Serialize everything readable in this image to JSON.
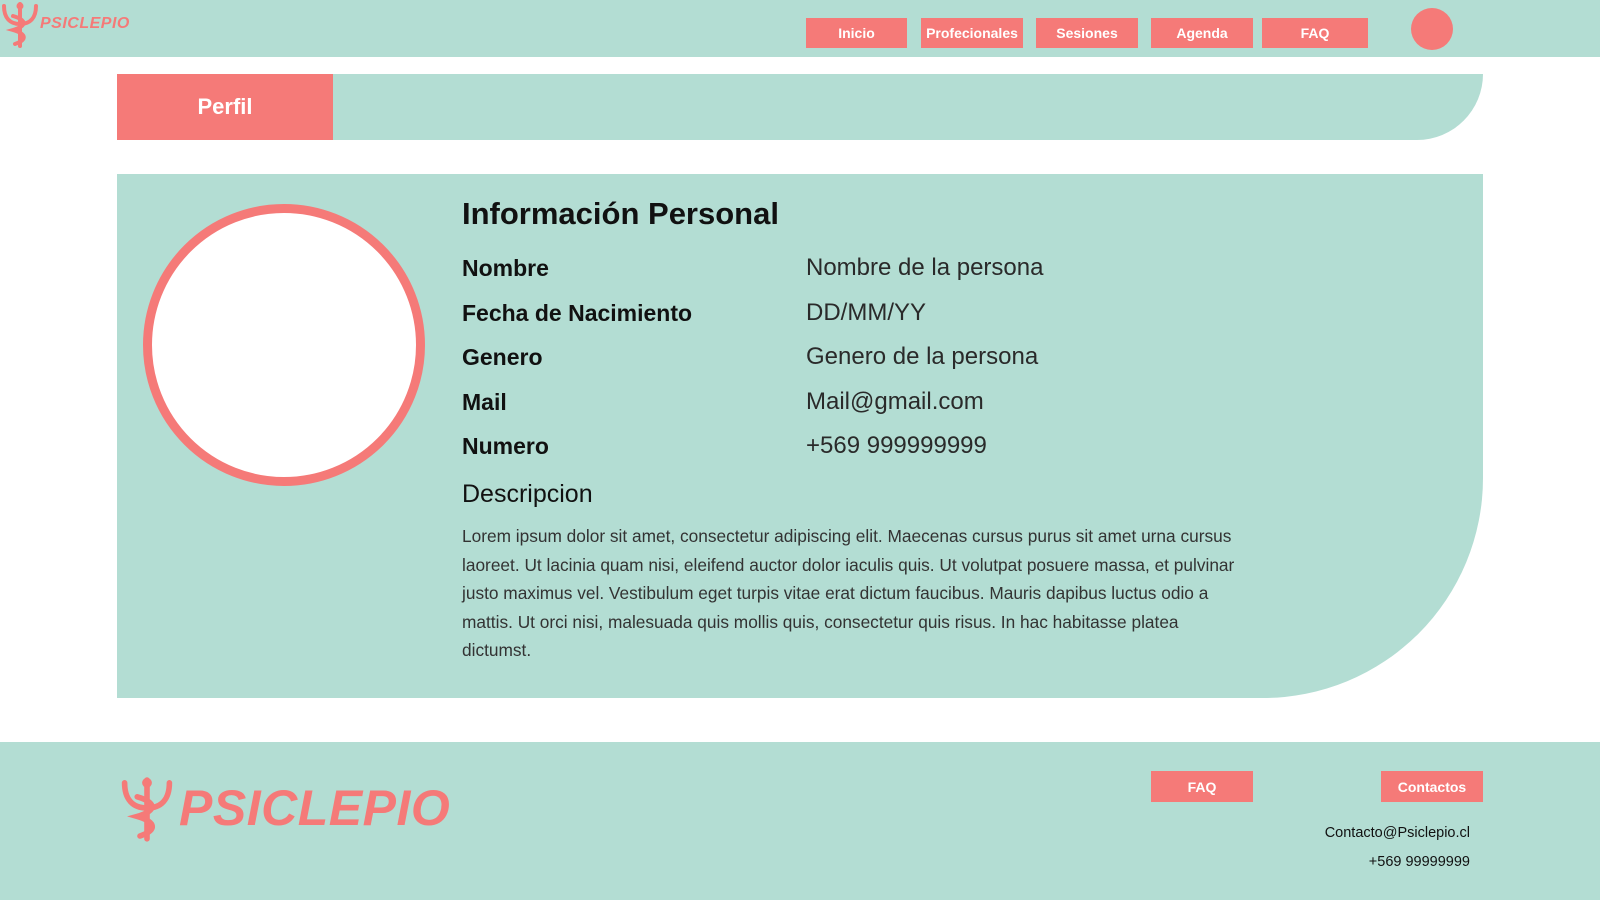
{
  "colors": {
    "accent": "#f57a78",
    "mint": "#b3ddd3",
    "white": "#ffffff"
  },
  "brand": {
    "name": "PSICLEPIO",
    "icon": "caduceus-psi-icon"
  },
  "nav": {
    "items": [
      {
        "label": "Inicio"
      },
      {
        "label": "Profecionales"
      },
      {
        "label": "Sesiones"
      },
      {
        "label": "Agenda"
      },
      {
        "label": "FAQ"
      }
    ],
    "avatar_icon": "user-avatar-icon"
  },
  "profile_tab": {
    "label": "Perfil"
  },
  "personal_info": {
    "title": "Información Personal",
    "fields": [
      {
        "label": "Nombre",
        "value": "Nombre de la persona"
      },
      {
        "label": "Fecha de Nacimiento",
        "value": "DD/MM/YY"
      },
      {
        "label": "Genero",
        "value": "Genero de la persona"
      },
      {
        "label": "Mail",
        "value": "Mail@gmail.com"
      },
      {
        "label": "Numero",
        "value": "+569 999999999"
      }
    ],
    "description_title": "Descripcion",
    "description": "Lorem ipsum dolor sit amet, consectetur adipiscing elit. Maecenas cursus purus sit amet urna cursus laoreet. Ut lacinia quam nisi, eleifend auctor dolor iaculis quis. Ut volutpat posuere massa, et pulvinar justo maximus vel. Vestibulum eget turpis vitae erat dictum faucibus. Mauris dapibus luctus odio a mattis. Ut orci nisi, malesuada quis mollis quis, consectetur quis risus. In hac habitasse platea dictumst."
  },
  "footer": {
    "buttons": [
      {
        "label": "FAQ"
      },
      {
        "label": "Contactos"
      }
    ],
    "email": "Contacto@Psiclepio.cl",
    "phone": "+569 99999999"
  }
}
